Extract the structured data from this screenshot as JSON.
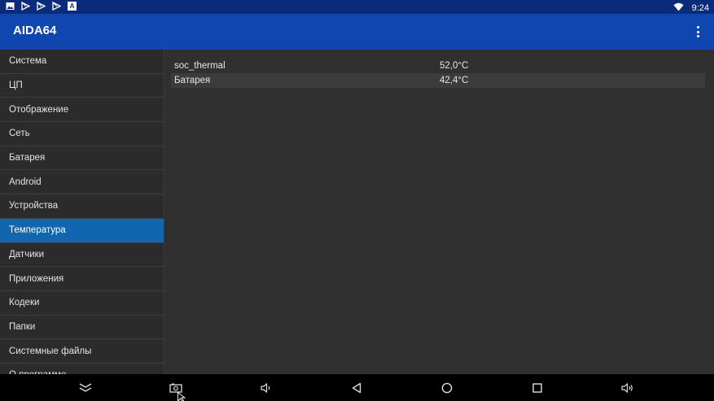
{
  "status_bar": {
    "time": "9:24",
    "icons": [
      "gallery-icon",
      "play-store-icon",
      "play-store-icon",
      "play-store-icon",
      "a-notification-icon"
    ],
    "boxed_glyph": "A"
  },
  "app": {
    "title": "AIDA64"
  },
  "sidebar": {
    "items": [
      {
        "label": "Система"
      },
      {
        "label": "ЦП"
      },
      {
        "label": "Отображение"
      },
      {
        "label": "Сеть"
      },
      {
        "label": "Батарея"
      },
      {
        "label": "Android"
      },
      {
        "label": "Устройства"
      },
      {
        "label": "Температура"
      },
      {
        "label": "Датчики"
      },
      {
        "label": "Приложения"
      },
      {
        "label": "Кодеки"
      },
      {
        "label": "Папки"
      },
      {
        "label": "Системные файлы"
      },
      {
        "label": "О программе"
      }
    ],
    "active": "Температура"
  },
  "main": {
    "rows": [
      {
        "name": "soc_thermal",
        "value": "52,0°C"
      },
      {
        "name": "Батарея",
        "value": "42,4°C"
      }
    ]
  },
  "navbar": {
    "icons": [
      "hide-bar-icon",
      "screenshot-icon",
      "volume-down-icon",
      "back-icon",
      "home-icon",
      "recents-icon",
      "volume-up-icon"
    ]
  },
  "colors": {
    "status_bar": "#0a2a7a",
    "app_bar": "#1046b0",
    "active_item": "#1266b0",
    "sidebar_bg": "#2b2b2b",
    "content_bg": "#303030"
  }
}
